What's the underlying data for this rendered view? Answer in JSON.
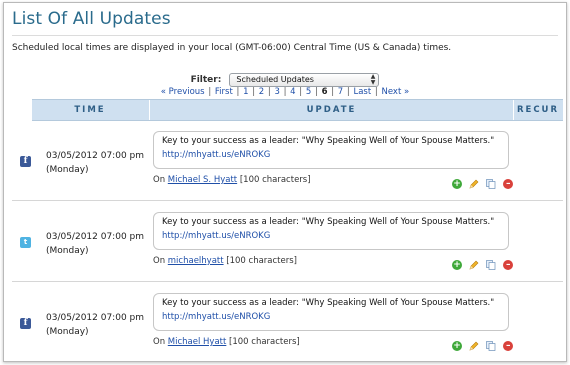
{
  "page": {
    "title": "List Of All Updates",
    "timezone_note": "Scheduled local times are displayed in your local (GMT-06:00) Central Time (US & Canada) times."
  },
  "filter": {
    "label": "Filter:",
    "selected": "Scheduled Updates",
    "arrows_icon": "select-arrows-icon"
  },
  "pager": {
    "previous": "« Previous",
    "first": "First",
    "pages": [
      "1",
      "2",
      "3",
      "4",
      "5",
      "6",
      "7"
    ],
    "current": "6",
    "last": "Last",
    "next": "Next »"
  },
  "table": {
    "headers": {
      "time": "TIME",
      "update": "UPDATE",
      "recur": "RECUR"
    }
  },
  "updates": [
    {
      "network_icon": "facebook-icon",
      "date": "03/05/2012 07:00 pm",
      "weekday": "(Monday)",
      "text": "Key to your success as a leader: \"Why Speaking Well of Your Spouse Matters.\"",
      "link": "http://mhyatt.us/eNROKG",
      "on_label": "On",
      "account": "Michael S. Hyatt",
      "chars": "[100 characters]"
    },
    {
      "network_icon": "twitter-icon",
      "date": "03/05/2012 07:00 pm",
      "weekday": "(Monday)",
      "text": "Key to your success as a leader: \"Why Speaking Well of Your Spouse Matters.\"",
      "link": "http://mhyatt.us/eNROKG",
      "on_label": "On",
      "account": "michaelhyatt",
      "chars": "[100 characters]"
    },
    {
      "network_icon": "facebook-icon",
      "date": "03/05/2012 07:00 pm",
      "weekday": "(Monday)",
      "text": "Key to your success as a leader: \"Why Speaking Well of Your Spouse Matters.\"",
      "link": "http://mhyatt.us/eNROKG",
      "on_label": "On",
      "account": "Michael Hyatt",
      "chars": "[100 characters]"
    }
  ],
  "row_actions": [
    "add-icon",
    "edit-pencil-icon",
    "copy-icon",
    "delete-icon"
  ],
  "colors": {
    "title": "#2a6b8c",
    "header_bg": "#cfe0f0",
    "link": "#1f4fa8",
    "facebook": "#3b5998",
    "twitter": "#4fb3e2",
    "add": "#3fa83a",
    "delete": "#d9413b"
  }
}
